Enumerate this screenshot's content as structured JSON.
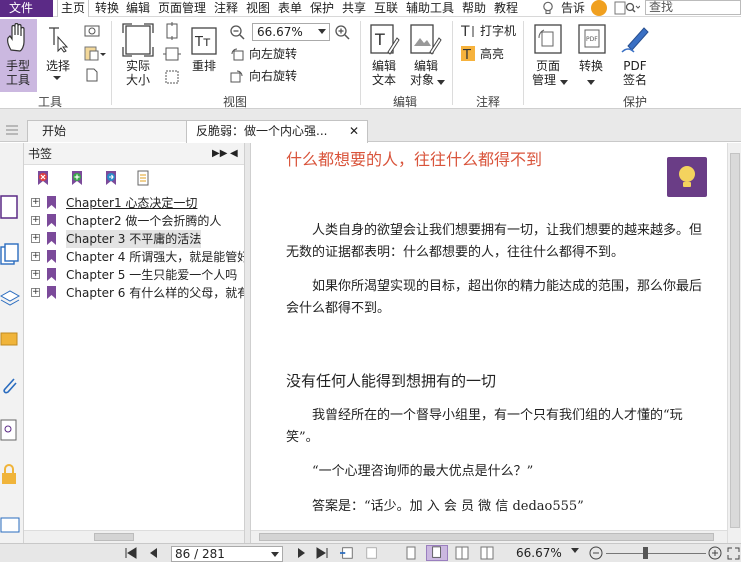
{
  "menu": {
    "file": "文件",
    "items": [
      "主页",
      "转换",
      "编辑",
      "页面管理",
      "注释",
      "视图",
      "表单",
      "保护",
      "共享",
      "互联",
      "辅助工具",
      "帮助",
      "教程"
    ],
    "tell_me": "告诉",
    "search_placeholder": "查找"
  },
  "ribbon": {
    "hand_tool": [
      "手型",
      "工具"
    ],
    "select": "选择",
    "actual_size": [
      "实际",
      "大小"
    ],
    "reflow": "重排",
    "zoom_value": "66.67%",
    "rotate_left": "向左旋转",
    "rotate_right": "向右旋转",
    "edit_text": [
      "编辑",
      "文本"
    ],
    "edit_object": [
      "编辑",
      "对象"
    ],
    "typewriter": "打字机",
    "highlight": "高亮",
    "page_manage": [
      "页面",
      "管理"
    ],
    "convert": "转换",
    "pdf_sign": [
      "PDF",
      "签名"
    ],
    "groups": {
      "tools": "工具",
      "view": "视图",
      "edit": "编辑",
      "comment": "注释",
      "protect": "保护"
    }
  },
  "tabs": {
    "home": "开始",
    "current": "反脆弱：做一个内心强..."
  },
  "bookmarks": {
    "title": "书签",
    "items": [
      "Chapter1 心态决定一切",
      "Chapter2 做一个会折腾的人",
      "Chapter 3 不平庸的活法",
      "Chapter 4 所谓强大，就是能管好",
      "Chapter 5 一生只能爱一个人吗",
      "Chapter 6 有什么样的父母，就有"
    ],
    "selected_index": 2
  },
  "document": {
    "heading1": "什么都想要的人，往往什么都得不到",
    "p1": "人类自身的欲望会让我们想要拥有一切，让我们想要的越来越多。但无数的证据都表明：什么都想要的人，往往什么都得不到。",
    "p2": "如果你所渴望实现的目标，超出你的精力能达成的范围，那么你最后会什么都得不到。",
    "heading2": "没有任何人能得到想拥有的一切",
    "p3": "我曾经所在的一个督导小组里，有一个只有我们组的人才懂的“玩笑”。",
    "p4": "“一个心理咨询师的最大优点是什么？”",
    "p5": "答案是：“话少。加 入 会 员 微 信 dedao555”"
  },
  "status": {
    "page": "86 / 281",
    "zoom": "66.67%"
  },
  "colors": {
    "brand": "#5b2a86",
    "hand_highlight": "#cbb8e0",
    "heading_red": "#d9543b",
    "bookmark_flag": "#7b4a9a"
  }
}
